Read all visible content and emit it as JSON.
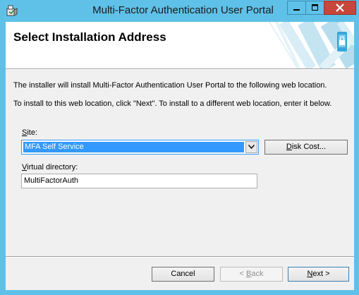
{
  "window": {
    "title": "Multi-Factor Authentication User Portal",
    "icon": "installer-icon",
    "controls": [
      "minimize-icon",
      "maximize-icon",
      "close-icon"
    ]
  },
  "banner": {
    "title": "Select Installation Address",
    "art_icon": "mobile-lock-icon"
  },
  "body": {
    "line1": "The installer will install Multi-Factor Authentication User Portal to the following web location.",
    "line2": "To install to this web location, click \"Next\". To install to a different web location, enter it below."
  },
  "site": {
    "label_prefix": "",
    "label_underlined": "S",
    "label_rest": "ite:",
    "selected_value": "MFA Self Service"
  },
  "disk_cost": {
    "underlined": "D",
    "rest": "isk Cost..."
  },
  "virtual_directory": {
    "label_underlined": "V",
    "label_rest": "irtual directory:",
    "value": "MultiFactorAuth"
  },
  "footer": {
    "cancel_label": "Cancel",
    "back_prefix": "< ",
    "back_underlined": "B",
    "back_rest": "ack",
    "next_underlined": "N",
    "next_rest": "ext >"
  },
  "colors": {
    "titlebar": "#5fc1e8",
    "close_button": "#c7473b",
    "selection": "#3399ff",
    "dialog_bg": "#f0f0f0"
  }
}
